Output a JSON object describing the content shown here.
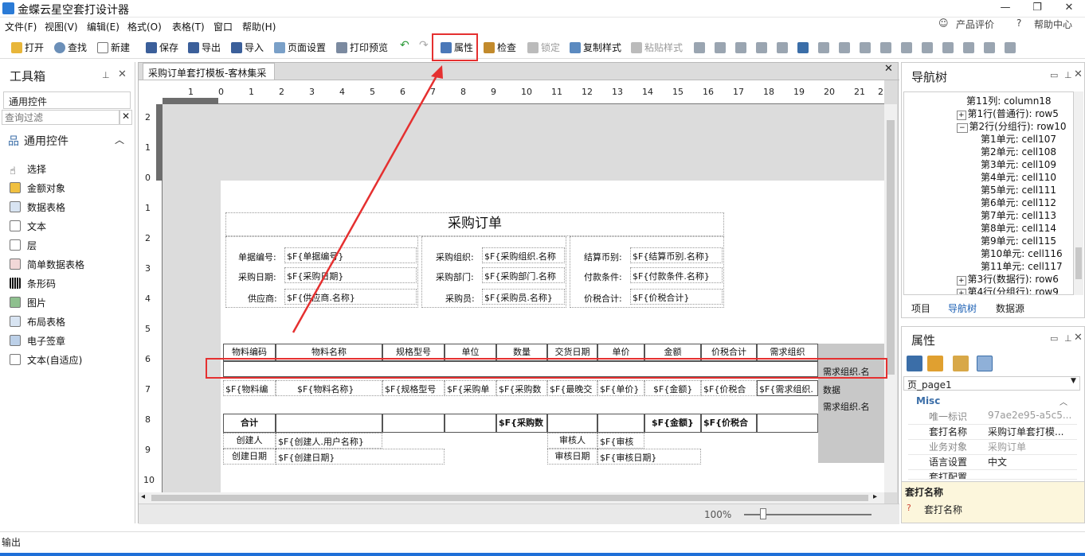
{
  "window": {
    "title": "金蝶云星空套打设计器",
    "min": "—",
    "restore": "❐",
    "close": "✕"
  },
  "menu": {
    "items": [
      "文件(F)",
      "视图(V)",
      "编辑(E)",
      "格式(O)",
      "表格(T)",
      "窗口",
      "帮助(H)"
    ],
    "rating": "产品评价",
    "help_center": "帮助中心"
  },
  "toolbar": {
    "open": "打开",
    "find": "查找",
    "new": "新建",
    "save": "保存",
    "export": "导出",
    "import": "导入",
    "page_setup": "页面设置",
    "print_preview": "打印预览",
    "properties": "属性",
    "check": "检查",
    "lock": "锁定",
    "copy_style": "复制样式",
    "paste_style": "粘贴样式"
  },
  "toolbox": {
    "title": "工具箱",
    "group": "通用控件",
    "filter_placeholder": "查询过滤",
    "section": "通用控件",
    "tools": [
      "选择",
      "金额对象",
      "数据表格",
      "文本",
      "层",
      "简单数据表格",
      "条形码",
      "图片",
      "布局表格",
      "电子签章",
      "文本(自适应)"
    ]
  },
  "editor": {
    "tab": "采购订单套打模板-客林集采",
    "zoom": "100%",
    "ruler_h": [
      "1",
      "0",
      "1",
      "2",
      "3",
      "4",
      "5",
      "6",
      "7",
      "8",
      "9",
      "10",
      "11",
      "12",
      "13",
      "14",
      "15",
      "16",
      "17",
      "18",
      "19",
      "20",
      "21",
      "2"
    ],
    "ruler_v": [
      "2",
      "1",
      "0",
      "1",
      "2",
      "3",
      "4",
      "5",
      "6",
      "7",
      "8",
      "9",
      "10"
    ]
  },
  "form": {
    "title": "采购订单",
    "head": [
      [
        "单据编号:",
        "$F{单据编号}",
        "采购组织:",
        "$F{采购组织.名称",
        "结算币别:",
        "$F{结算币别.名称}"
      ],
      [
        "采购日期:",
        "$F{采购日期}",
        "采购部门:",
        "$F{采购部门.名称",
        "付款条件:",
        "$F{付款条件.名称}"
      ],
      [
        "供应商:",
        "$F{供应商.名称}",
        "采购员:",
        "$F{采购员.名称}",
        "价税合计:",
        "$F{价税合计}"
      ]
    ],
    "columns": [
      "物料编码",
      "物料名称",
      "规格型号",
      "单位",
      "数量",
      "交货日期",
      "单价",
      "金额",
      "价税合计",
      "需求组织"
    ],
    "data_row": [
      "$F{物料编",
      "$F{物料名称}",
      "$F{规格型号",
      "$F{采购单",
      "$F{采购数",
      "$F{最晚交",
      "$F{单价}",
      "$F{金额}",
      "$F{价税合",
      "$F{需求组织."
    ],
    "side_labels": [
      "需求组织.名",
      "数据",
      "需求组织.名"
    ],
    "total_label": "合计",
    "total_qty": "$F{采购数",
    "total_amount": "$F{金额}",
    "total_tax": "$F{价税合",
    "creator_label": "创建人",
    "creator_value": "$F{创建人.用户名称}",
    "auditor_label": "审核人",
    "auditor_value": "$F{审核",
    "create_date_label": "创建日期",
    "create_date_value": "$F{创建日期}",
    "audit_date_label": "审核日期",
    "audit_date_value": "$F{审核日期}"
  },
  "nav": {
    "title": "导航树",
    "tabs": [
      "项目",
      "导航树",
      "数据源"
    ],
    "nodes": [
      "第11列: column18",
      "第1行(普通行): row5",
      "第2行(分组行): row10",
      "第1单元: cell107",
      "第2单元: cell108",
      "第3单元: cell109",
      "第4单元: cell110",
      "第5单元: cell111",
      "第6单元: cell112",
      "第7单元: cell113",
      "第8单元: cell114",
      "第9单元: cell115",
      "第10单元: cell116",
      "第11单元: cell117",
      "第3行(数据行): row6",
      "第4行(分组行): row9"
    ]
  },
  "props": {
    "title": "属性",
    "object": "页_page1",
    "category": "Misc",
    "rows": [
      [
        "唯一标识",
        "97ae2e95-a5c5..."
      ],
      [
        "套打名称",
        "采购订单套打模..."
      ],
      [
        "业务对象",
        "采购订单"
      ],
      [
        "语言设置",
        "中文"
      ],
      [
        "套打配置",
        ""
      ]
    ],
    "desc_title": "套打名称",
    "desc_text": "套打名称"
  },
  "output": {
    "label": "输出"
  }
}
